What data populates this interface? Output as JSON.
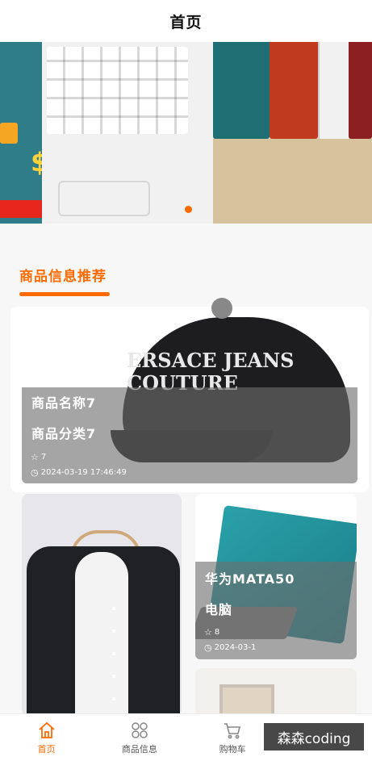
{
  "header": {
    "title": "首页"
  },
  "banner": {
    "indicator_color": "#ff6a00"
  },
  "section": {
    "title": "商品信息推荐"
  },
  "products": [
    {
      "name": "商品名称7",
      "category": "商品分类7",
      "likes": "7",
      "time": "2024-03-19 17:46:49"
    },
    {
      "name": "华为MATA50",
      "category": "电脑",
      "likes": "8",
      "time": "2024-03-1"
    }
  ],
  "tabbar": {
    "items": [
      {
        "label": "首页",
        "icon": "home-icon",
        "active": true
      },
      {
        "label": "商品信息",
        "icon": "grid-icon",
        "active": false
      },
      {
        "label": "购物车",
        "icon": "cart-icon",
        "active": false
      }
    ]
  },
  "watermark": {
    "text": "森森coding"
  },
  "colors": {
    "accent": "#ff6a00",
    "overlay": "rgba(110,110,110,0.62)"
  }
}
